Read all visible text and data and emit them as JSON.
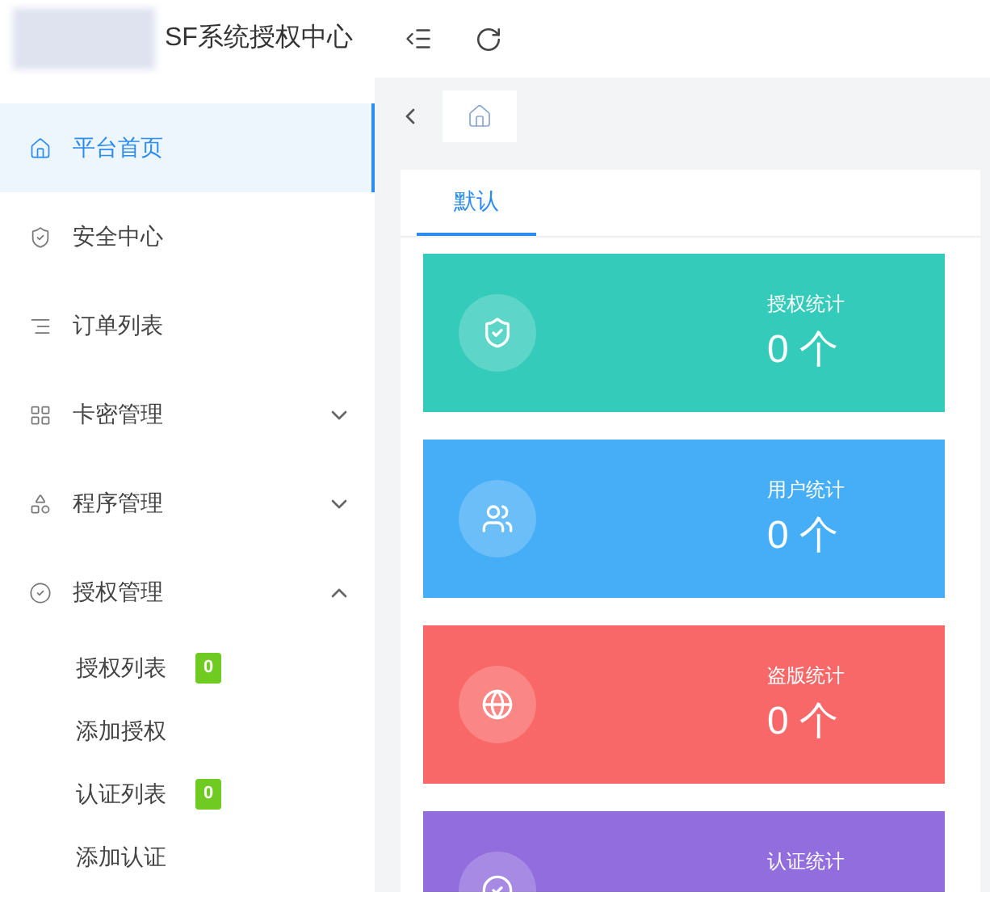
{
  "brand": {
    "title": "SF系统授权中心"
  },
  "menu": [
    {
      "label": "平台首页",
      "selected": true
    },
    {
      "label": "安全中心",
      "selected": false
    },
    {
      "label": "订单列表",
      "selected": false
    },
    {
      "label": "卡密管理",
      "selected": false,
      "expanded": false
    },
    {
      "label": "程序管理",
      "selected": false,
      "expanded": false
    },
    {
      "label": "授权管理",
      "selected": false,
      "expanded": true,
      "children": [
        {
          "label": "授权列表",
          "badge": "0"
        },
        {
          "label": "添加授权"
        },
        {
          "label": "认证列表",
          "badge": "0"
        },
        {
          "label": "添加认证"
        }
      ]
    }
  ],
  "tabs": [
    {
      "label": "默认",
      "selected": true
    }
  ],
  "stats": [
    {
      "label": "授权统计",
      "value": "0 个",
      "color": "#35cbbb"
    },
    {
      "label": "用户统计",
      "value": "0 个",
      "color": "#46aef7"
    },
    {
      "label": "盗版统计",
      "value": "0 个",
      "color": "#f96868"
    },
    {
      "label": "认证统计",
      "color": "#926dde"
    }
  ]
}
